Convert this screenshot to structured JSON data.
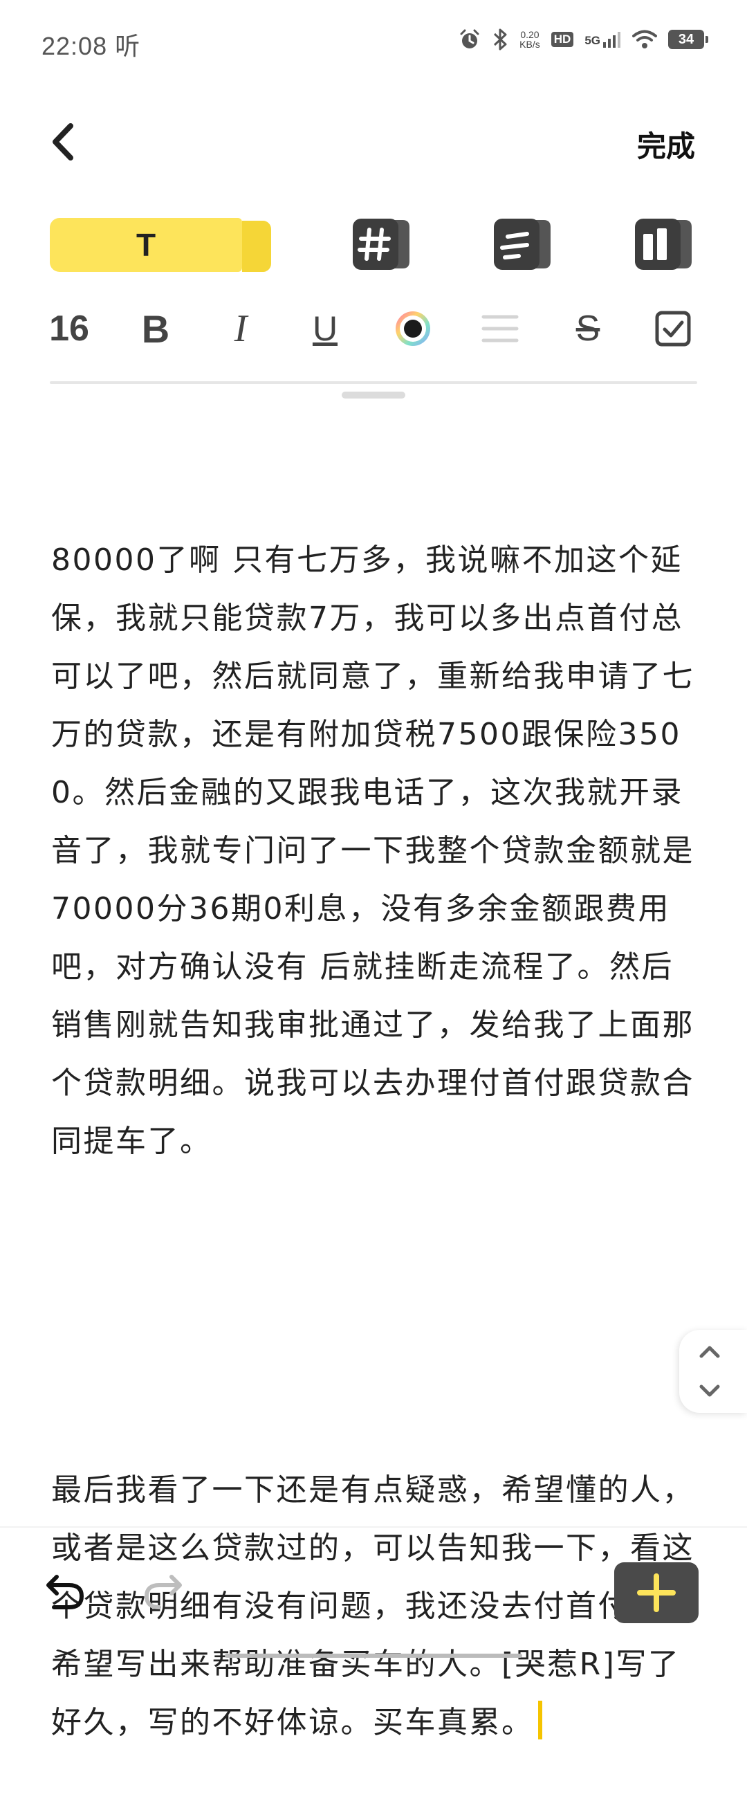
{
  "status_bar": {
    "time": "22:08",
    "carrier_glyph": "听",
    "net_speed_value": "0.20",
    "net_speed_unit": "KB/s",
    "hd_label": "HD",
    "signal_label": "5G",
    "battery": "34"
  },
  "header": {
    "done_label": "完成"
  },
  "mode_tabs": {
    "text_tab_label": "T",
    "icons": [
      "hashtag-icon",
      "list-icon",
      "layout-icon"
    ]
  },
  "format_toolbar": {
    "font_size": "16",
    "bold": "B",
    "italic": "I",
    "underline": "U",
    "strike": "S",
    "color_accent": "#1b1b1b"
  },
  "content": {
    "paragraph1": "80000了啊 只有七万多，我说嘛不加这个延保，我就只能贷款7万，我可以多出点首付总可以了吧，然后就同意了，重新给我申请了七万的贷款，还是有附加贷税7500跟保险3500。然后金融的又跟我电话了，这次我就开录音了，我就专门问了一下我整个贷款金额就是70000分36期0利息，没有多余金额跟费用吧，对方确认没有 后就挂断走流程了。然后销售刚就告知我审批通过了，发给我了上面那个贷款明细。说我可以去办理付首付跟贷款合同提车了。",
    "paragraph2": "最后我看了一下还是有点疑惑，希望懂的人，或者是这么贷款过的，可以告知我一下，看这个贷款明细有没有问题，我还没去付首付，也希望写出来帮助准备买车的人。[哭惹R]写了好久，写的不好体谅。买车真累。"
  },
  "colors": {
    "accent_yellow": "#fde45b",
    "caret": "#f5c400",
    "add_button_bg": "#4a4a4a"
  }
}
